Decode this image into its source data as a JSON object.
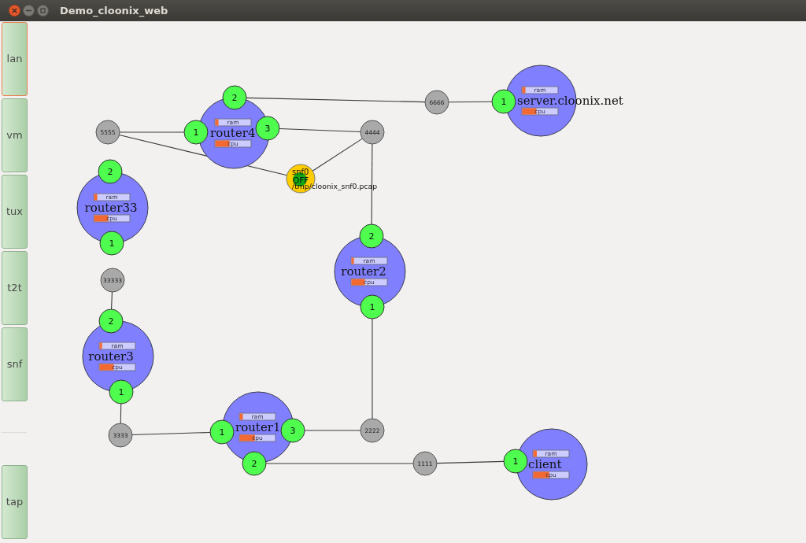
{
  "window": {
    "title": "Demo_cloonix_web"
  },
  "sidebar": {
    "groups": [
      {
        "items": [
          {
            "label": "lan",
            "selected": true
          },
          {
            "label": "vm",
            "selected": false
          },
          {
            "label": "tux",
            "selected": false
          },
          {
            "label": "t2t",
            "selected": false
          },
          {
            "label": "snf",
            "selected": false
          }
        ]
      },
      {
        "items": [
          {
            "label": "tap",
            "selected": false
          }
        ]
      }
    ]
  },
  "canvas": {
    "machines": [
      {
        "name": "router4",
        "meters": [
          {
            "label": "ram",
            "level": 0.09
          },
          {
            "label": "cpu",
            "level": 0.4
          }
        ],
        "interfaces": [
          "2",
          "1",
          "3"
        ]
      },
      {
        "name": "server.cloonix.net",
        "meters": [
          {
            "label": "ram",
            "level": 0.09
          },
          {
            "label": "cpu",
            "level": 0.4
          }
        ],
        "interfaces": [
          "1"
        ]
      },
      {
        "name": "router33",
        "meters": [
          {
            "label": "ram",
            "level": 0.09
          },
          {
            "label": "cpu",
            "level": 0.4
          }
        ],
        "interfaces": [
          "2",
          "1"
        ]
      },
      {
        "name": "router2",
        "meters": [
          {
            "label": "ram",
            "level": 0.07
          },
          {
            "label": "cpu",
            "level": 0.38
          }
        ],
        "interfaces": [
          "2",
          "1"
        ]
      },
      {
        "name": "router3",
        "meters": [
          {
            "label": "ram",
            "level": 0.07
          },
          {
            "label": "cpu",
            "level": 0.4
          }
        ],
        "interfaces": [
          "2",
          "1"
        ]
      },
      {
        "name": "router1",
        "meters": [
          {
            "label": "ram",
            "level": 0.09
          },
          {
            "label": "cpu",
            "level": 0.43
          }
        ],
        "interfaces": [
          "1",
          "3",
          "2"
        ]
      },
      {
        "name": "client",
        "meters": [
          {
            "label": "ram",
            "level": 0.1
          },
          {
            "label": "cpu",
            "level": 0.45
          }
        ],
        "interfaces": [
          "1"
        ]
      }
    ],
    "lans": [
      "6666",
      "5555",
      "4444",
      "33333",
      "3333",
      "2222",
      "1111"
    ],
    "sniffer": {
      "name": "snf0",
      "state": "OFF",
      "file": "/tmp/cloonix_snf0.pcap"
    }
  }
}
